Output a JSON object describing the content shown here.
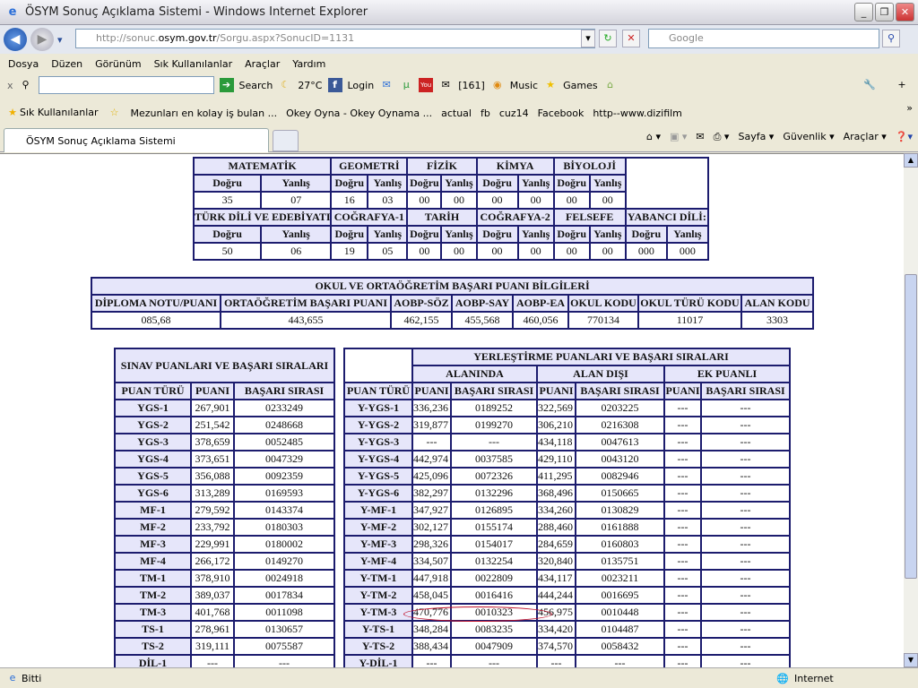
{
  "window": {
    "title": "ÖSYM Sonuç Açıklama Sistemi - Windows Internet Explorer",
    "minimize": "_",
    "restore": "❐",
    "close": "✕"
  },
  "address": {
    "url_prefix": "http://sonuc.",
    "url_domain": "osym.gov.tr",
    "url_rest": "/Sorgu.aspx?SonucID=1131",
    "search_placeholder": "Google"
  },
  "menu": [
    "Dosya",
    "Düzen",
    "Görünüm",
    "Sık Kullanılanlar",
    "Araçlar",
    "Yardım"
  ],
  "toolbar": {
    "search": "Search",
    "weather": "27°C",
    "login": "Login",
    "count": "[161]",
    "music": "Music",
    "games": "Games"
  },
  "favorites": [
    "Sık Kullanılanlar",
    "Mezunları en kolay iş bulan ...",
    "Okey Oyna - Okey Oynama ...",
    "actual",
    "fb",
    "cuz14",
    "Facebook",
    "http--www.dizifilm"
  ],
  "tab": {
    "label": "ÖSYM Sonuç Açıklama Sistemi"
  },
  "commands": [
    "Sayfa ▾",
    "Güvenlik ▾",
    "Araçlar ▾"
  ],
  "status": {
    "left": "Bitti",
    "zone": "Internet"
  },
  "answers": {
    "subjects1": [
      "MATEMATİK",
      "GEOMETRİ",
      "FİZİK",
      "KİMYA",
      "BİYOLOJİ"
    ],
    "values1": [
      "35",
      "07",
      "16",
      "03",
      "00",
      "00",
      "00",
      "00",
      "00",
      "00"
    ],
    "subjects2": [
      "TÜRK DİLİ VE EDEBİYATI",
      "COĞRAFYA-1",
      "TARİH",
      "COĞRAFYA-2",
      "FELSEFE",
      "YABANCI DİLİ:"
    ],
    "values2": [
      "50",
      "06",
      "19",
      "05",
      "00",
      "00",
      "00",
      "00",
      "00",
      "00",
      "000",
      "000"
    ],
    "correct": "Doğru",
    "wrong": "Yanlış"
  },
  "school": {
    "title": "OKUL VE ORTAÖĞRETİM BAŞARI PUANI BİLGİLERİ",
    "headers": [
      "DİPLOMA NOTU/PUANI",
      "ORTAÖĞRETİM BAŞARI PUANI",
      "AOBP-SÖZ",
      "AOBP-SAY",
      "AOBP-EA",
      "OKUL KODU",
      "OKUL TÜRÜ KODU",
      "ALAN KODU"
    ],
    "values": [
      "085,68",
      "443,655",
      "462,155",
      "455,568",
      "460,056",
      "770134",
      "11017",
      "3303"
    ]
  },
  "exam": {
    "title": "SINAV PUANLARI VE BAŞARI SIRALARI",
    "headers": [
      "PUAN TÜRÜ",
      "PUANI",
      "BAŞARI SIRASI"
    ],
    "rows": [
      [
        "YGS-1",
        "267,901",
        "0233249"
      ],
      [
        "YGS-2",
        "251,542",
        "0248668"
      ],
      [
        "YGS-3",
        "378,659",
        "0052485"
      ],
      [
        "YGS-4",
        "373,651",
        "0047329"
      ],
      [
        "YGS-5",
        "356,088",
        "0092359"
      ],
      [
        "YGS-6",
        "313,289",
        "0169593"
      ],
      [
        "MF-1",
        "279,592",
        "0143374"
      ],
      [
        "MF-2",
        "233,792",
        "0180303"
      ],
      [
        "MF-3",
        "229,991",
        "0180002"
      ],
      [
        "MF-4",
        "266,172",
        "0149270"
      ],
      [
        "TM-1",
        "378,910",
        "0024918"
      ],
      [
        "TM-2",
        "389,037",
        "0017834"
      ],
      [
        "TM-3",
        "401,768",
        "0011098"
      ],
      [
        "TS-1",
        "278,961",
        "0130657"
      ],
      [
        "TS-2",
        "319,111",
        "0075587"
      ],
      [
        "DİL-1",
        "---",
        "---"
      ]
    ]
  },
  "placement": {
    "title": "YERLEŞTİRME PUANLARI VE BAŞARI SIRALARI",
    "groups": [
      "ALANINDA",
      "ALAN DIŞI",
      "EK PUANLI"
    ],
    "headers": [
      "PUAN TÜRÜ",
      "PUANI",
      "BAŞARI SIRASI",
      "PUANI",
      "BAŞARI SIRASI",
      "PUANI",
      "BAŞARI SIRASI"
    ],
    "highlight_color": "#c0102a",
    "rows": [
      [
        "Y-YGS-1",
        "336,236",
        "0189252",
        "322,569",
        "0203225",
        "---",
        "---"
      ],
      [
        "Y-YGS-2",
        "319,877",
        "0199270",
        "306,210",
        "0216308",
        "---",
        "---"
      ],
      [
        "Y-YGS-3",
        "---",
        "---",
        "434,118",
        "0047613",
        "---",
        "---"
      ],
      [
        "Y-YGS-4",
        "442,974",
        "0037585",
        "429,110",
        "0043120",
        "---",
        "---"
      ],
      [
        "Y-YGS-5",
        "425,096",
        "0072326",
        "411,295",
        "0082946",
        "---",
        "---"
      ],
      [
        "Y-YGS-6",
        "382,297",
        "0132296",
        "368,496",
        "0150665",
        "---",
        "---"
      ],
      [
        "Y-MF-1",
        "347,927",
        "0126895",
        "334,260",
        "0130829",
        "---",
        "---"
      ],
      [
        "Y-MF-2",
        "302,127",
        "0155174",
        "288,460",
        "0161888",
        "---",
        "---"
      ],
      [
        "Y-MF-3",
        "298,326",
        "0154017",
        "284,659",
        "0160803",
        "---",
        "---"
      ],
      [
        "Y-MF-4",
        "334,507",
        "0132254",
        "320,840",
        "0135751",
        "---",
        "---"
      ],
      [
        "Y-TM-1",
        "447,918",
        "0022809",
        "434,117",
        "0023211",
        "---",
        "---"
      ],
      [
        "Y-TM-2",
        "458,045",
        "0016416",
        "444,244",
        "0016695",
        "---",
        "---"
      ],
      [
        "Y-TM-3",
        "470,776",
        "0010323",
        "456,975",
        "0010448",
        "---",
        "---"
      ],
      [
        "Y-TS-1",
        "348,284",
        "0083235",
        "334,420",
        "0104487",
        "---",
        "---"
      ],
      [
        "Y-TS-2",
        "388,434",
        "0047909",
        "374,570",
        "0058432",
        "---",
        "---"
      ],
      [
        "Y-DİL-1",
        "---",
        "---",
        "---",
        "---",
        "---",
        "---"
      ]
    ]
  }
}
